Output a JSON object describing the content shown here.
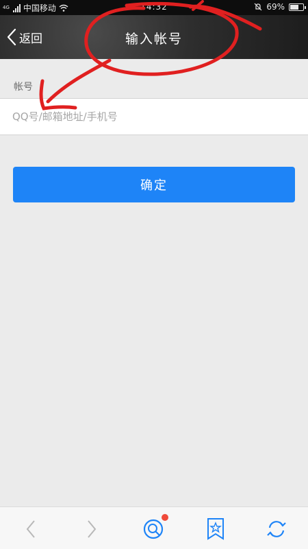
{
  "status_bar": {
    "network": "4G",
    "carrier": "中国移动",
    "time": "14:32",
    "battery": "69%",
    "battery_level": 0.69
  },
  "header": {
    "back_label": "返回",
    "title": "输入帐号"
  },
  "form": {
    "account_label": "帐号",
    "account_placeholder": "QQ号/邮箱地址/手机号",
    "account_value": "",
    "confirm_label": "确定"
  },
  "bottom_bar": {
    "items": [
      "back-icon",
      "forward-icon",
      "search-icon",
      "bookmark-icon",
      "refresh-icon"
    ],
    "notification": true
  },
  "colors": {
    "accent": "#1e84f7",
    "annotation": "#e02020",
    "notification": "#f04a3a"
  }
}
